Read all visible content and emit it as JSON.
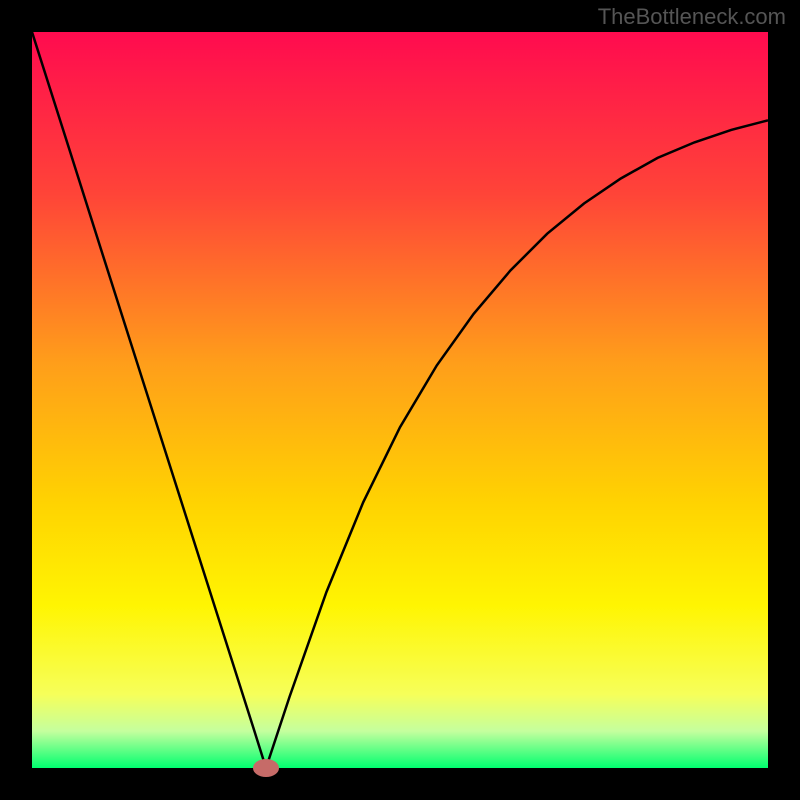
{
  "watermark": "TheBottleneck.com",
  "chart_data": {
    "type": "line",
    "title": "",
    "xlabel": "",
    "ylabel": "",
    "xlim": [
      0,
      1
    ],
    "ylim": [
      0,
      1
    ],
    "background_gradient": {
      "stops": [
        {
          "pos": 0.0,
          "color": "#ff0b4f"
        },
        {
          "pos": 0.22,
          "color": "#ff4438"
        },
        {
          "pos": 0.45,
          "color": "#ff9e1a"
        },
        {
          "pos": 0.64,
          "color": "#ffd301"
        },
        {
          "pos": 0.78,
          "color": "#fff502"
        },
        {
          "pos": 0.9,
          "color": "#f6ff5a"
        },
        {
          "pos": 0.95,
          "color": "#c5ff9e"
        },
        {
          "pos": 1.0,
          "color": "#00ff6f"
        }
      ]
    },
    "series": [
      {
        "name": "curve",
        "x": [
          0.0,
          0.05,
          0.1,
          0.15,
          0.2,
          0.25,
          0.3,
          0.318,
          0.35,
          0.4,
          0.45,
          0.5,
          0.55,
          0.6,
          0.65,
          0.7,
          0.75,
          0.8,
          0.85,
          0.9,
          0.95,
          1.0
        ],
        "y": [
          1.0,
          0.843,
          0.685,
          0.528,
          0.371,
          0.214,
          0.057,
          0.0,
          0.097,
          0.239,
          0.361,
          0.463,
          0.547,
          0.617,
          0.676,
          0.726,
          0.767,
          0.801,
          0.829,
          0.85,
          0.867,
          0.88
        ]
      }
    ],
    "marker": {
      "x": 0.318,
      "y": 0.0,
      "color": "#c66b68"
    }
  }
}
